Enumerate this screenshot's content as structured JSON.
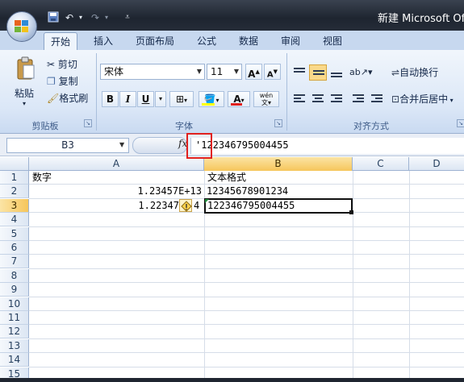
{
  "window": {
    "title": "新建 Microsoft Off"
  },
  "tabs": [
    "开始",
    "插入",
    "页面布局",
    "公式",
    "数据",
    "审阅",
    "视图"
  ],
  "clipboard": {
    "paste": "粘贴",
    "cut": "剪切",
    "copy": "复制",
    "format_painter": "格式刷",
    "group": "剪贴板"
  },
  "font": {
    "name": "宋体",
    "size": "11",
    "grow": "A",
    "shrink": "A",
    "bold": "B",
    "italic": "I",
    "underline": "U",
    "font_color_letter": "A",
    "phonetic": "wén",
    "group": "字体"
  },
  "alignment": {
    "wrap_text": "自动换行",
    "merge_center": "合并后居中",
    "group": "对齐方式"
  },
  "formula_bar": {
    "name_box": "B3",
    "fx": "fx",
    "content": "'122346795004455"
  },
  "columns": [
    "A",
    "B",
    "C",
    "D"
  ],
  "rows": [
    "1",
    "2",
    "3",
    "4",
    "5",
    "6",
    "7",
    "8",
    "9",
    "10",
    "11",
    "12",
    "13",
    "14",
    "15"
  ],
  "cells": {
    "A1": "数字",
    "B1": "文本格式",
    "A2": "1.23457E+13",
    "B2": "12345678901234",
    "A3": "1.22347",
    "A3_tail": "4",
    "B3": "122346795004455"
  },
  "selection": {
    "active_cell": "B3",
    "active_column": "B",
    "active_row": "3"
  },
  "icons": [
    "office-button",
    "save-icon",
    "undo-icon",
    "redo-icon",
    "customize-qat-icon",
    "paste-icon",
    "scissors-icon",
    "copy-icon",
    "format-painter-icon",
    "border-icon",
    "fill-color-icon",
    "phonetic-icon",
    "align-icon",
    "indent-icon",
    "orientation-icon",
    "wrap-text-icon",
    "merge-icon",
    "error-warning-icon",
    "dialog-launcher-icon"
  ],
  "colors": {
    "selection_highlight": "#f6c65b",
    "highlight_box": "#e0201e",
    "font_color_bar": "#e0201e",
    "fill_color_bar": "#ffff00"
  }
}
